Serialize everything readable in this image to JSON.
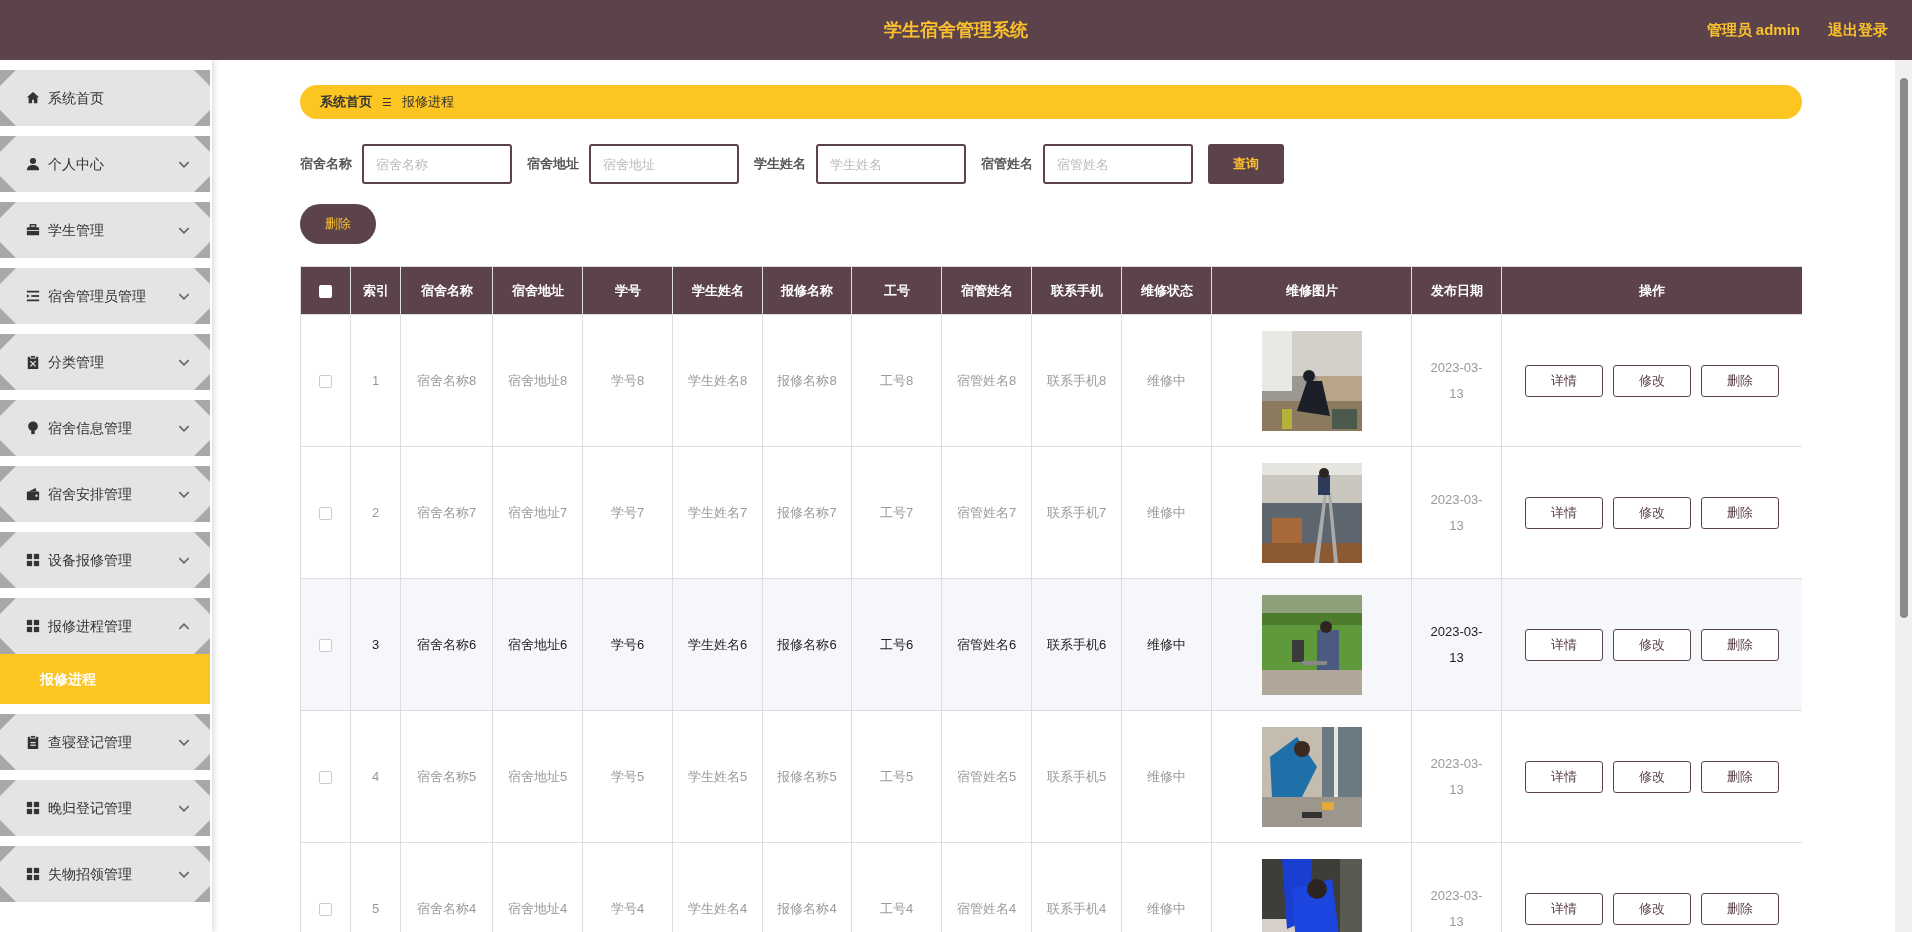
{
  "header": {
    "title": "学生宿舍管理系统",
    "user": "管理员 admin",
    "logout": "退出登录"
  },
  "sidebar": {
    "items": [
      {
        "label": "系统首页"
      },
      {
        "label": "个人中心",
        "expanded": false
      },
      {
        "label": "学生管理",
        "expanded": false
      },
      {
        "label": "宿舍管理员管理",
        "expanded": false
      },
      {
        "label": "分类管理",
        "expanded": false
      },
      {
        "label": "宿舍信息管理",
        "expanded": false
      },
      {
        "label": "宿舍安排管理",
        "expanded": false
      },
      {
        "label": "设备报修管理",
        "expanded": false
      },
      {
        "label": "报修进程管理",
        "expanded": true,
        "children": [
          {
            "label": "报修进程",
            "selected": true
          }
        ]
      },
      {
        "label": "查寝登记管理",
        "expanded": false
      },
      {
        "label": "晚归登记管理",
        "expanded": false
      },
      {
        "label": "失物招领管理",
        "expanded": false
      }
    ]
  },
  "breadcrumb": {
    "home": "系统首页",
    "separator": "☰",
    "current": "报修进程"
  },
  "search": {
    "fields": [
      {
        "label": "宿舍名称",
        "placeholder": "宿舍名称"
      },
      {
        "label": "宿舍地址",
        "placeholder": "宿舍地址"
      },
      {
        "label": "学生姓名",
        "placeholder": "学生姓名"
      },
      {
        "label": "宿管姓名",
        "placeholder": "宿管姓名"
      }
    ],
    "button": "查询"
  },
  "delete_button": "删除",
  "table": {
    "select_all": {
      "checked": false
    },
    "columns": [
      "索引",
      "宿舍名称",
      "宿舍地址",
      "学号",
      "学生姓名",
      "报修名称",
      "工号",
      "宿管姓名",
      "联系手机",
      "维修状态",
      "维修图片",
      "发布日期",
      "操作"
    ],
    "rows": [
      {
        "checked": false,
        "highlighted": false,
        "cells": [
          "1",
          "宿舍名称8",
          "宿舍地址8",
          "学号8",
          "学生姓名8",
          "报修名称8",
          "工号8",
          "宿管姓名8",
          "联系手机8",
          "维修中"
        ],
        "photo": {
          "kind": "picture"
        },
        "date": "2023-03-13",
        "actions": [
          "详情",
          "修改",
          "删除"
        ]
      },
      {
        "checked": false,
        "highlighted": false,
        "cells": [
          "2",
          "宿舍名称7",
          "宿舍地址7",
          "学号7",
          "学生姓名7",
          "报修名称7",
          "工号7",
          "宿管姓名7",
          "联系手机7",
          "维修中"
        ],
        "photo": {
          "kind": "picture"
        },
        "date": "2023-03-13",
        "actions": [
          "详情",
          "修改",
          "删除"
        ]
      },
      {
        "checked": false,
        "highlighted": true,
        "cells": [
          "3",
          "宿舍名称6",
          "宿舍地址6",
          "学号6",
          "学生姓名6",
          "报修名称6",
          "工号6",
          "宿管姓名6",
          "联系手机6",
          "维修中"
        ],
        "photo": {
          "kind": "picture"
        },
        "date": "2023-03-13",
        "actions": [
          "详情",
          "修改",
          "删除"
        ]
      },
      {
        "checked": false,
        "highlighted": false,
        "cells": [
          "4",
          "宿舍名称5",
          "宿舍地址5",
          "学号5",
          "学生姓名5",
          "报修名称5",
          "工号5",
          "宿管姓名5",
          "联系手机5",
          "维修中"
        ],
        "photo": {
          "kind": "picture"
        },
        "date": "2023-03-13",
        "actions": [
          "详情",
          "修改",
          "删除"
        ]
      },
      {
        "checked": false,
        "highlighted": false,
        "cells": [
          "5",
          "宿舍名称4",
          "宿舍地址4",
          "学号4",
          "学生姓名4",
          "报修名称4",
          "工号4",
          "宿管姓名4",
          "联系手机4",
          "维修中"
        ],
        "photo": {
          "kind": "picture"
        },
        "date": "2023-03-13",
        "actions": [
          "详情",
          "修改",
          "删除"
        ]
      }
    ]
  }
}
